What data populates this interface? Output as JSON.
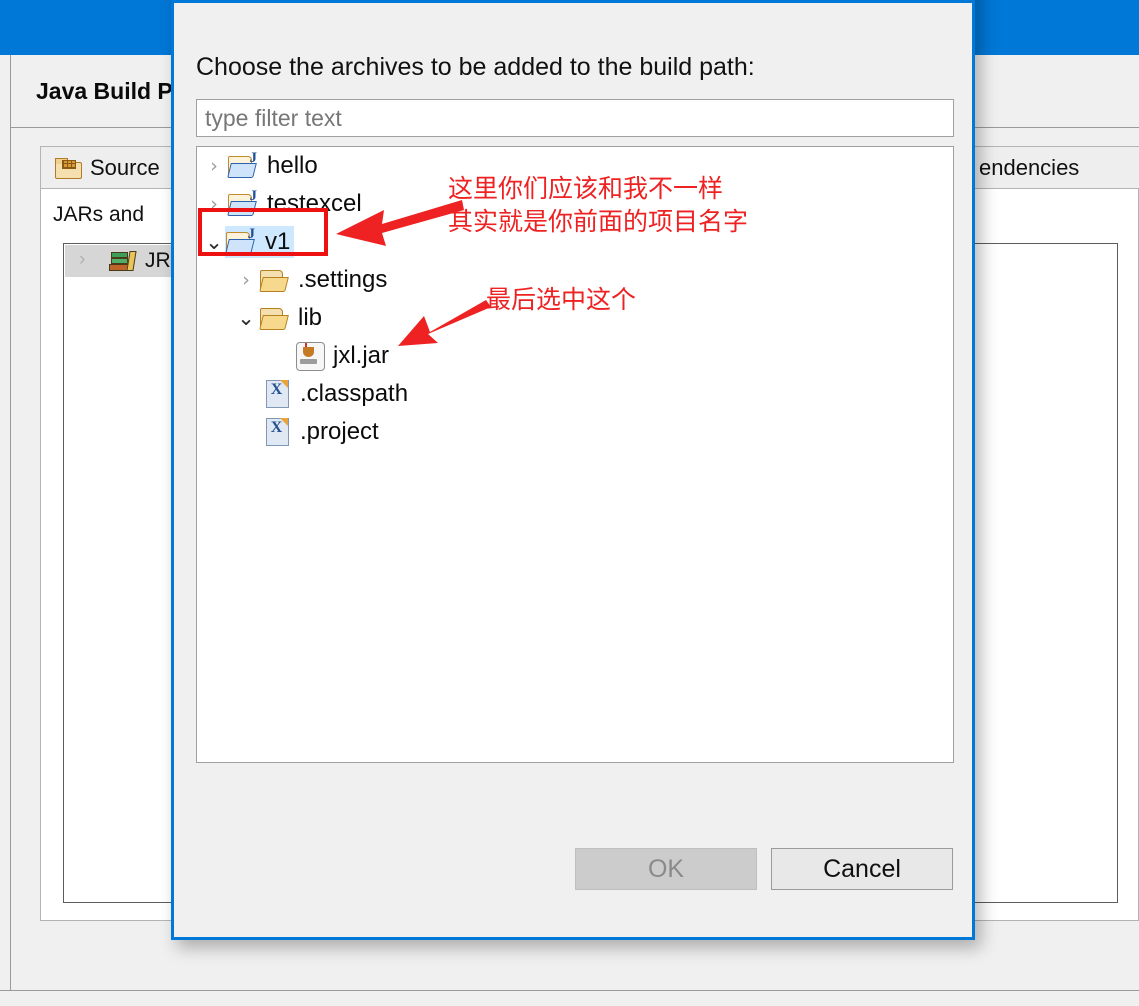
{
  "background": {
    "page_title": "Java Build Path",
    "tabs": [
      {
        "label": "Source",
        "icon": "source-folder-icon"
      },
      {
        "label": "endencies",
        "icon": "none"
      }
    ],
    "panel_label": "JARs and ",
    "tree_rows": [
      {
        "label": "JRE",
        "icon": "jre-library-icon",
        "twisty": "›"
      }
    ]
  },
  "dialog": {
    "title": "",
    "window_controls": {
      "minimize": "minimize-icon",
      "close": "close-icon"
    },
    "prompt": "Choose the archives to be added to the build path:",
    "filter": {
      "value": "",
      "placeholder": "type filter text"
    },
    "tree": [
      {
        "label": "hello",
        "icon": "java-project-folder-icon",
        "twisty": "›",
        "state": "collapsed",
        "indent": 0,
        "selected": false
      },
      {
        "label": "testexcel",
        "icon": "java-project-folder-icon",
        "twisty": "›",
        "state": "collapsed",
        "indent": 0,
        "selected": false
      },
      {
        "label": "v1",
        "icon": "java-project-folder-icon",
        "twisty": "⌄",
        "state": "expanded",
        "indent": 0,
        "selected": true
      },
      {
        "label": ".settings",
        "icon": "folder-icon",
        "twisty": "›",
        "state": "collapsed",
        "indent": 1,
        "selected": false
      },
      {
        "label": "lib",
        "icon": "folder-icon",
        "twisty": "⌄",
        "state": "expanded",
        "indent": 1,
        "selected": false
      },
      {
        "label": "jxl.jar",
        "icon": "jar-file-icon",
        "twisty": "",
        "state": "leaf",
        "indent": 2,
        "selected": false
      },
      {
        "label": ".classpath",
        "icon": "xml-file-icon",
        "twisty": "",
        "state": "leaf",
        "indent": 1,
        "selected": false
      },
      {
        "label": ".project",
        "icon": "xml-file-icon",
        "twisty": "",
        "state": "leaf",
        "indent": 1,
        "selected": false
      }
    ],
    "buttons": {
      "ok": "OK",
      "cancel": "Cancel"
    }
  },
  "annotations": {
    "color": "#ee2222",
    "note_1_line_1": "这里你们应该和我不一样",
    "note_1_line_2": "其实就是你前面的项目名字",
    "note_2": "最后选中这个",
    "highlight_target": "v1"
  }
}
